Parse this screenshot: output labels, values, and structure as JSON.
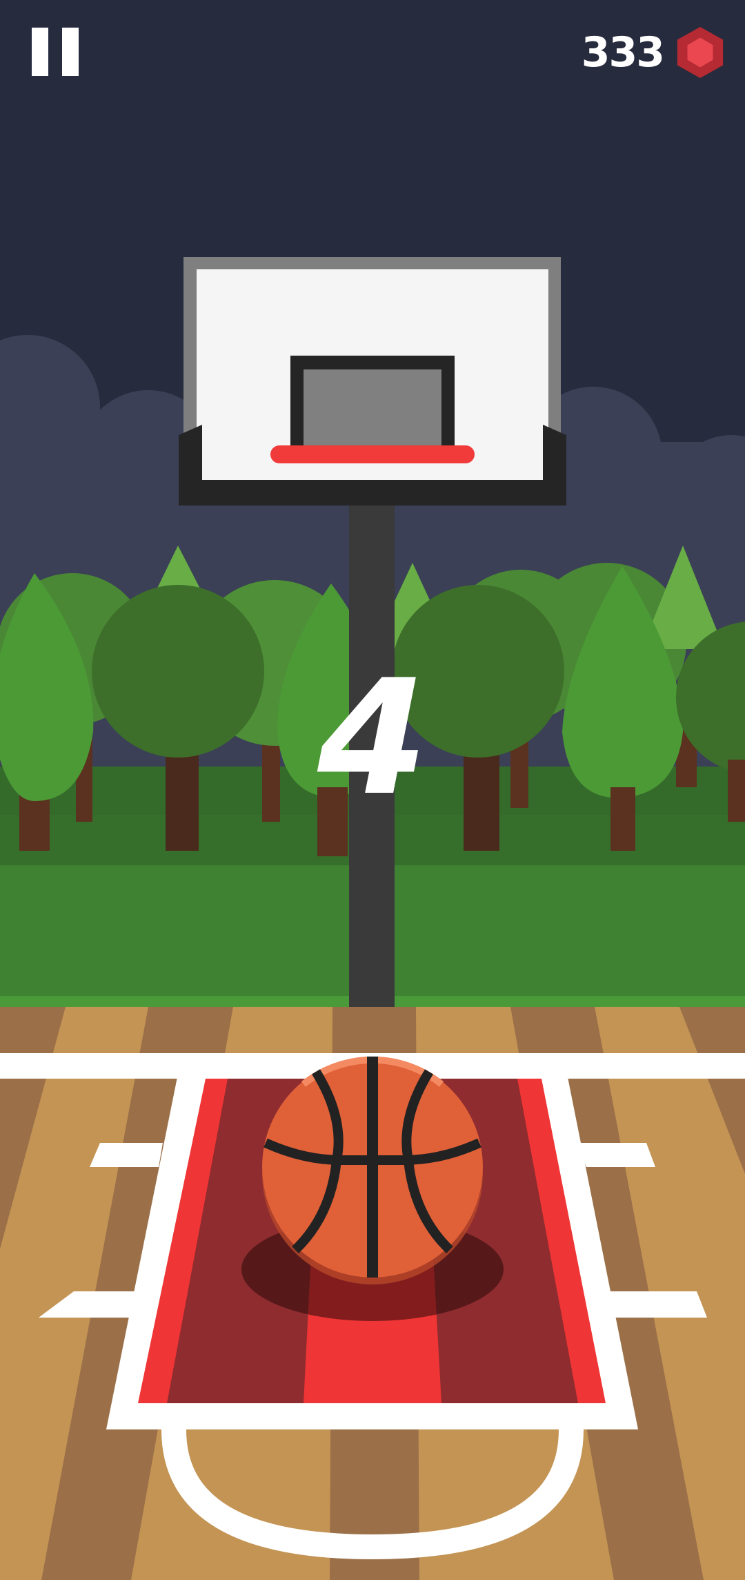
{
  "hud": {
    "pause_icon": "pause-icon",
    "gem_count": "333",
    "gem_icon": "hexagon-gem-icon"
  },
  "game": {
    "shot_count": "4"
  },
  "colors": {
    "sky": "#272b3e",
    "clouds": "#3b4056",
    "grass": "#3e8232",
    "court_wood_light": "#c49454",
    "court_wood_dark": "#9b7049",
    "key_paint": "#8e2c2f",
    "key_stripe": "#ef3535",
    "rim": "#f13a3a",
    "ball": "#e06038",
    "gem": "#d9353d"
  }
}
